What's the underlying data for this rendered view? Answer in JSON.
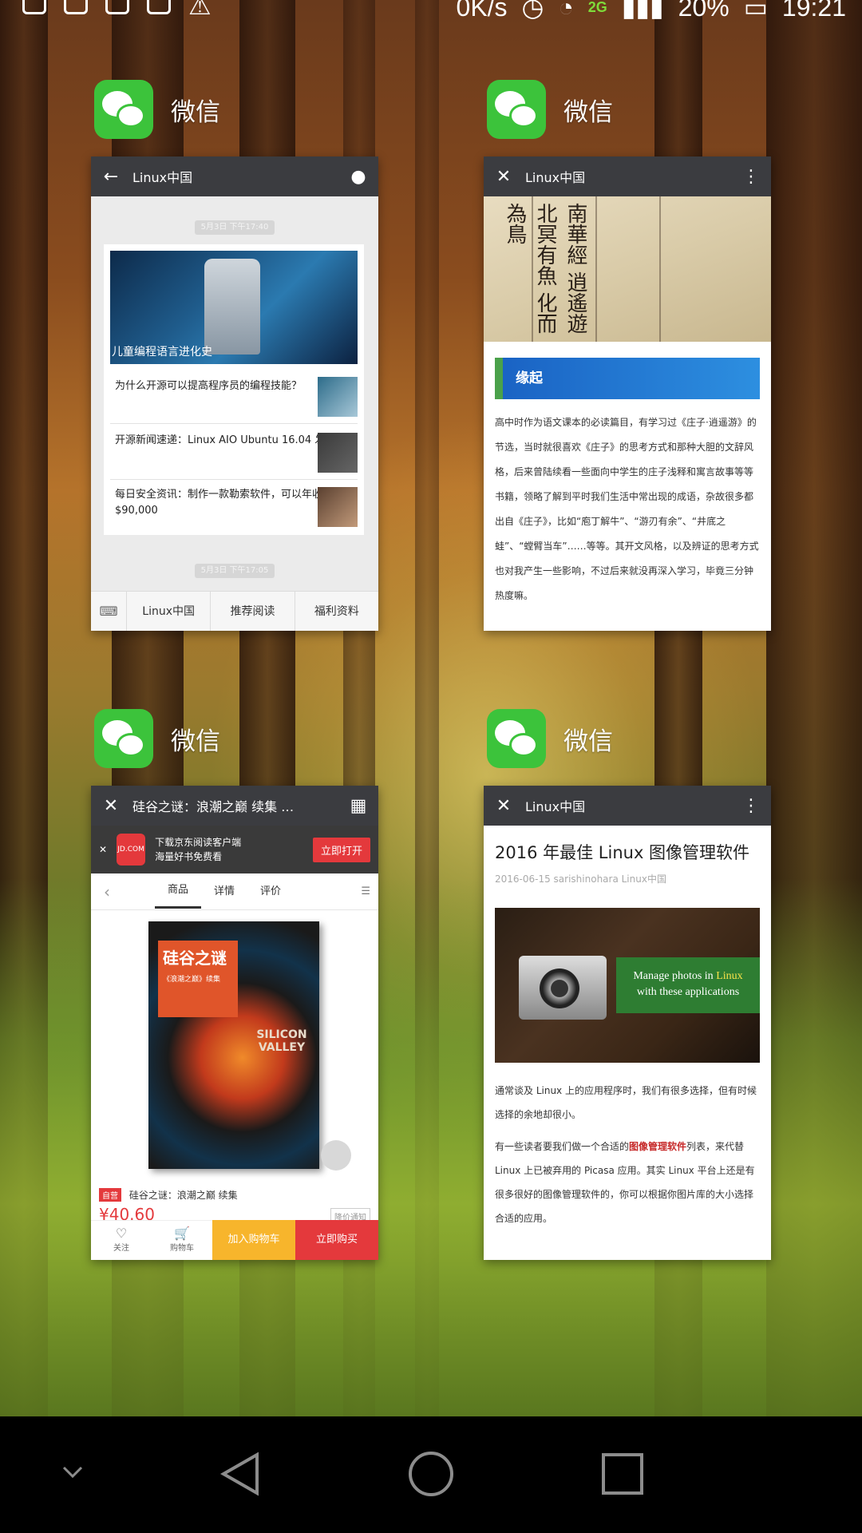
{
  "status_bar": {
    "speed": "0K/s",
    "network_type": "2G",
    "battery": "20%",
    "time": "19:21"
  },
  "cards": [
    {
      "app_name": "微信",
      "title": "Linux中国",
      "timestamp1": "5月3日 下午17:40",
      "timestamp2": "5月3日 下午17:05",
      "hero_caption": "儿童编程语言进化史",
      "items": [
        "为什么开源可以提高程序员的编程技能？",
        "开源新闻速递：Linux AIO Ubuntu 16.04 发布",
        "每日安全资讯：制作一款勒索软件，可以年收入$90,000"
      ],
      "menu": [
        "Linux中国",
        "推荐阅读",
        "福利资料"
      ]
    },
    {
      "app_name": "微信",
      "title": "Linux中国",
      "section": "缘起",
      "body": "高中时作为语文课本的必读篇目，有学习过《庄子·逍遥游》的节选，当时就很喜欢《庄子》的思考方式和那种大胆的文辞风格，后来曾陆续看一些面向中学生的庄子浅释和寓言故事等等书籍，领略了解到平时我们生活中常出现的成语，杂故很多都出自《庄子》，比如“庖丁解牛”、“游刃有余”、“井底之蛙”、“螳臂当车”……等等。其开文风格，以及辨证的思考方式也对我产生一些影响，不过后来就没再深入学习，毕竟三分钟热度嘛。"
    },
    {
      "app_name": "微信",
      "title": "硅谷之谜：浪潮之巅 续集 …",
      "banner_line1": "下载京东阅读客户端",
      "banner_line2": "海量好书免费看",
      "banner_button": "立即打开",
      "tabs": [
        "商品",
        "详情",
        "评价"
      ],
      "book_title": "硅谷之谜",
      "book_subtitle": "《浪潮之巅》续集",
      "book_en": "SILICON VALLEY",
      "self_tag": "自营",
      "product_name": "硅谷之谜：浪潮之巅 续集",
      "price": "¥40.60",
      "notice": "降价通知",
      "bottom": {
        "follow": "关注",
        "cart_icon_label": "购物车",
        "add_cart": "加入购物车",
        "buy": "立即购买"
      }
    },
    {
      "app_name": "微信",
      "title": "Linux中国",
      "article_title": "2016 年最佳 Linux 图像管理软件",
      "meta": "2016-06-15 sarishinohara Linux中国",
      "overlay_line1_a": "Manage photos in ",
      "overlay_line1_b": "Linux",
      "overlay_line2": "with these applications",
      "para1": "通常谈及 Linux 上的应用程序时，我们有很多选择，但有时候选择的余地却很小。",
      "para2_a": "有一些读者要我们做一个合适的",
      "para2_red": "图像管理软件",
      "para2_b": "列表，来代替 Linux 上已被弃用的 Picasa 应用。其实 Linux 平台上还是有很多很好的图像管理软件的，你可以根据你图片库的大小选择合适的应用。"
    }
  ]
}
